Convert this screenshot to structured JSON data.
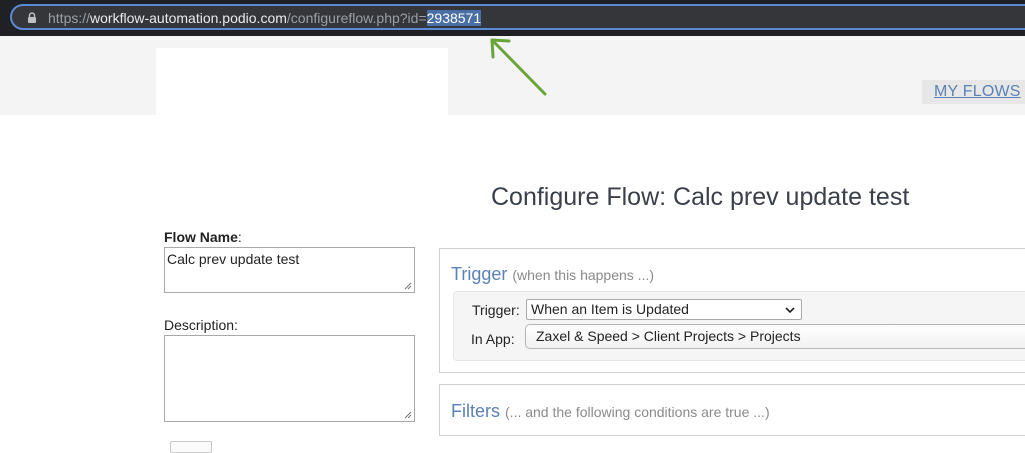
{
  "browser": {
    "url_scheme": "https://",
    "url_host": "workflow-automation.podio.com",
    "url_path": "/configureflow.php?id=",
    "url_id_selected": "2938571"
  },
  "header": {
    "my_flows_link": "MY FLOWS"
  },
  "page_title": "Configure Flow: Calc prev update test",
  "left_column": {
    "flow_name_label": "Flow Name",
    "flow_name_colon": ":",
    "flow_name_value": "Calc prev update test",
    "description_label": "Description:",
    "description_value": ""
  },
  "trigger_panel": {
    "title": "Trigger",
    "hint": "(when this happens ...)",
    "trigger_label": "Trigger:",
    "trigger_selected": "When an Item is Updated",
    "in_app_label": "In App:",
    "in_app_selected": "Zaxel & Speed > Client Projects > Projects"
  },
  "filters_panel": {
    "title": "Filters",
    "hint": "(... and the following conditions are true ...)"
  },
  "colors": {
    "accent_blue": "#5a82b4",
    "arrow_green": "#6aa53a",
    "browser_dark": "#202124",
    "url_selection": "#4a6fa5"
  },
  "icons": {
    "lock": "lock-icon",
    "arrow": "annotation-arrow-icon",
    "chevron": "chevron-down-icon",
    "resize": "resize-grip-icon"
  }
}
